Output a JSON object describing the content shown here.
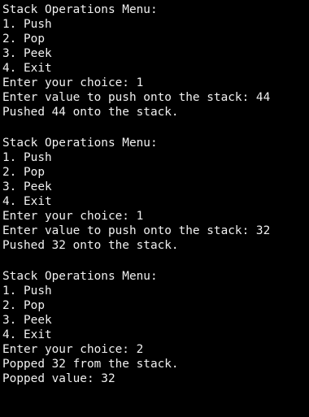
{
  "terminal": {
    "blocks": [
      {
        "menu_title": "Stack Operations Menu:",
        "options": [
          "1. Push",
          "2. Pop",
          "3. Peek",
          "4. Exit"
        ],
        "choice_line": "Enter your choice: 1",
        "output_lines": [
          "Enter value to push onto the stack: 44",
          "Pushed 44 onto the stack."
        ]
      },
      {
        "menu_title": "Stack Operations Menu:",
        "options": [
          "1. Push",
          "2. Pop",
          "3. Peek",
          "4. Exit"
        ],
        "choice_line": "Enter your choice: 1",
        "output_lines": [
          "Enter value to push onto the stack: 32",
          "Pushed 32 onto the stack."
        ]
      },
      {
        "menu_title": "Stack Operations Menu:",
        "options": [
          "1. Push",
          "2. Pop",
          "3. Peek",
          "4. Exit"
        ],
        "choice_line": "Enter your choice: 2",
        "output_lines": [
          "Popped 32 from the stack.",
          "Popped value: 32"
        ]
      }
    ]
  },
  "colors": {
    "background": "#000000",
    "text": "#f0f0f0"
  }
}
